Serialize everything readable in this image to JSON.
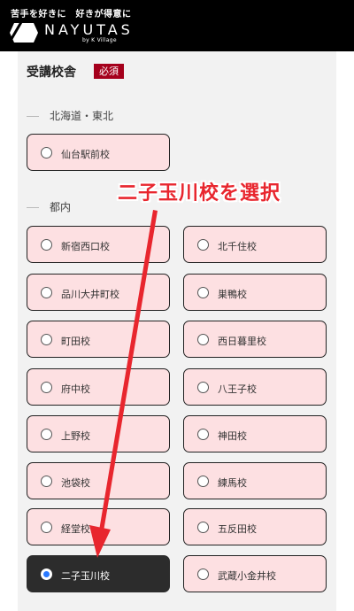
{
  "header": {
    "tagline": "苦手を好きに　好きが得意に",
    "logo_text": "NAYUTAS",
    "logo_sub": "by K Village"
  },
  "form": {
    "title": "受講校舎",
    "required_badge": "必須"
  },
  "regions": [
    {
      "name": "北海道・東北"
    },
    {
      "name": "都内"
    }
  ],
  "options": [
    {
      "label": "仙台駅前校",
      "selected": false
    },
    {
      "label": "新宿西口校",
      "selected": false
    },
    {
      "label": "北千住校",
      "selected": false
    },
    {
      "label": "品川大井町校",
      "selected": false
    },
    {
      "label": "巣鴨校",
      "selected": false
    },
    {
      "label": "町田校",
      "selected": false
    },
    {
      "label": "西日暮里校",
      "selected": false
    },
    {
      "label": "府中校",
      "selected": false
    },
    {
      "label": "八王子校",
      "selected": false
    },
    {
      "label": "上野校",
      "selected": false
    },
    {
      "label": "神田校",
      "selected": false
    },
    {
      "label": "池袋校",
      "selected": false
    },
    {
      "label": "練馬校",
      "selected": false
    },
    {
      "label": "経堂校",
      "selected": false
    },
    {
      "label": "五反田校",
      "selected": false
    },
    {
      "label": "二子玉川校",
      "selected": true
    },
    {
      "label": "武蔵小金井校",
      "selected": false
    }
  ],
  "annotation": {
    "text": "二子玉川校を選択",
    "color": "#e8262e"
  },
  "colors": {
    "option_bg": "#fde0e2",
    "selected_bg": "#2c2c2c",
    "badge_bg": "#a5001c",
    "radio_selected": "#2979ff"
  }
}
